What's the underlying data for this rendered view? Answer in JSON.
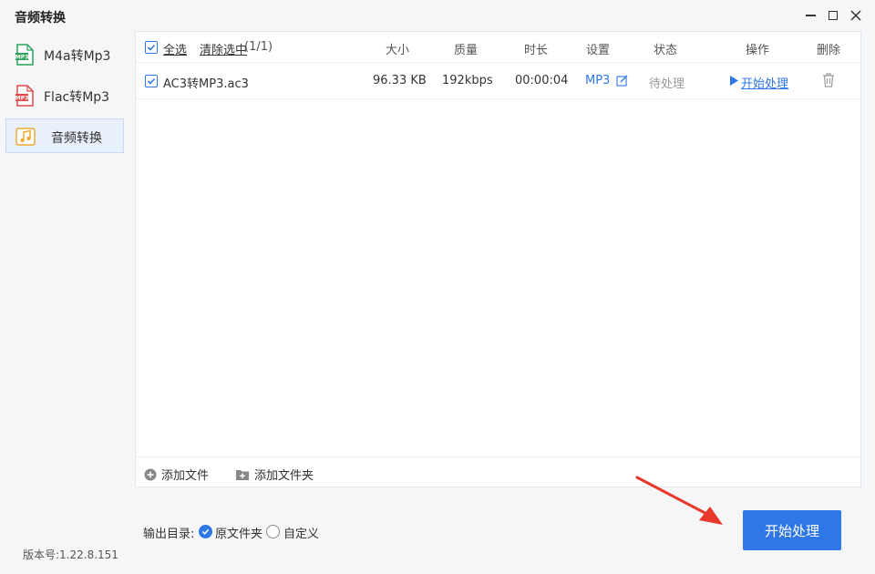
{
  "app": {
    "title": "音频转换"
  },
  "sidebar": {
    "items": [
      {
        "label": "M4a转Mp3",
        "icon": "mp3-file-icon",
        "icon_text": "MP3",
        "icon_color": "#2aa05a"
      },
      {
        "label": "Flac转Mp3",
        "icon": "mp3-file-icon",
        "icon_text": "MP3",
        "icon_color": "#e04848"
      },
      {
        "label": "音频转换",
        "icon": "music-note-icon",
        "icon_color": "#f0a830",
        "active": true
      }
    ],
    "version": "版本号:1.22.8.151"
  },
  "table": {
    "select_all": "全选",
    "clear_selected": "清除选中",
    "selected_count": "(1/1)",
    "columns": {
      "size": "大小",
      "quality": "质量",
      "duration": "时长",
      "settings": "设置",
      "status": "状态",
      "action": "操作",
      "delete": "删除"
    },
    "rows": [
      {
        "checked": true,
        "name": "AC3转MP3.ac3",
        "size": "96.33 KB",
        "quality": "192kbps",
        "duration": "00:00:04",
        "format": "MP3",
        "status": "待处理",
        "action": "开始处理"
      }
    ]
  },
  "footer": {
    "add_file": "添加文件",
    "add_folder": "添加文件夹"
  },
  "output": {
    "label": "输出目录:",
    "options": [
      {
        "label": "原文件夹",
        "selected": true
      },
      {
        "label": "自定义",
        "selected": false
      }
    ]
  },
  "start_button": "开始处理",
  "colors": {
    "accent": "#2f77e6",
    "annotation_arrow": "#e8382c"
  }
}
